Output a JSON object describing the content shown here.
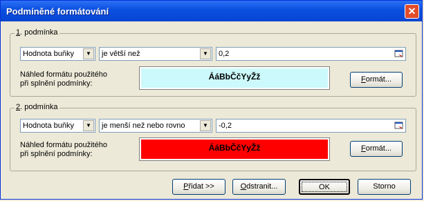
{
  "window": {
    "title": "Podmíněné formátování"
  },
  "conditions": [
    {
      "label_key": "1",
      "label_rest": ". podmínka",
      "type": "Hodnota buňky",
      "operator": "je větší než",
      "value": "0,2",
      "preview_label_line1": "Náhled formátu použitého",
      "preview_label_line2": "při splnění podmínky:",
      "preview_text": "ÁáBbČčYyŽž",
      "preview_bg": "#ccf9fb",
      "format_key": "F",
      "format_rest": "ormát..."
    },
    {
      "label_key": "2",
      "label_rest": ". podmínka",
      "type": "Hodnota buňky",
      "operator": "je menší než nebo rovno",
      "value": "-0,2",
      "preview_label_line1": "Náhled formátu použitého",
      "preview_label_line2": "při splnění podmínky:",
      "preview_text": "ÁáBbČčYyŽž",
      "preview_bg": "#ff0000",
      "format_key": "F",
      "format_rest": "ormát..."
    }
  ],
  "buttons": {
    "add_key": "P",
    "add_rest": "řidat >>",
    "remove_key": "O",
    "remove_rest": "dstranit...",
    "ok": "OK",
    "cancel": "Storno"
  },
  "icons": {
    "close": "close-x",
    "collapse": "collapse-dialog"
  }
}
